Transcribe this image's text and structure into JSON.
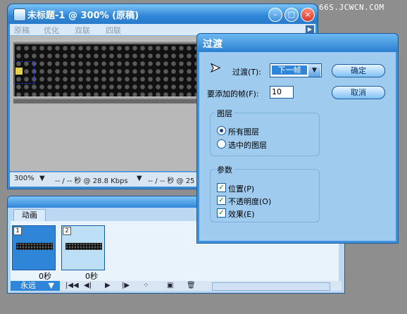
{
  "watermark": "66S.JCWCN.COM",
  "document": {
    "title": "未标题-1 @ 300% (原稿)",
    "tabs": [
      "原稿",
      "优化",
      "双联",
      "四联"
    ],
    "status": {
      "zoom": "300%",
      "speed1": "-- / -- 秒 @ 28.8 Kbps",
      "speed2": "-- / -- 秒 @ 25"
    }
  },
  "animation_panel": {
    "tab_label": "动画",
    "frames": [
      {
        "number": "1",
        "time": "0秒",
        "selected": true
      },
      {
        "number": "2",
        "time": "0秒",
        "selected": false
      }
    ],
    "loop": "永远"
  },
  "dialog": {
    "title": "过渡",
    "transition_label": "过渡(T):",
    "transition_value": "下一帧",
    "frames_label": "要添加的帧(F):",
    "frames_value": "10",
    "ok_label": "确定",
    "cancel_label": "取消",
    "layers_group": "图层",
    "layer_options": [
      {
        "label": "所有图层",
        "selected": true
      },
      {
        "label": "选中的图层",
        "selected": false
      }
    ],
    "params_group": "参数",
    "params": [
      {
        "label": "位置(P)",
        "checked": true
      },
      {
        "label": "不透明度(O)",
        "checked": true
      },
      {
        "label": "效果(E)",
        "checked": true
      }
    ]
  }
}
